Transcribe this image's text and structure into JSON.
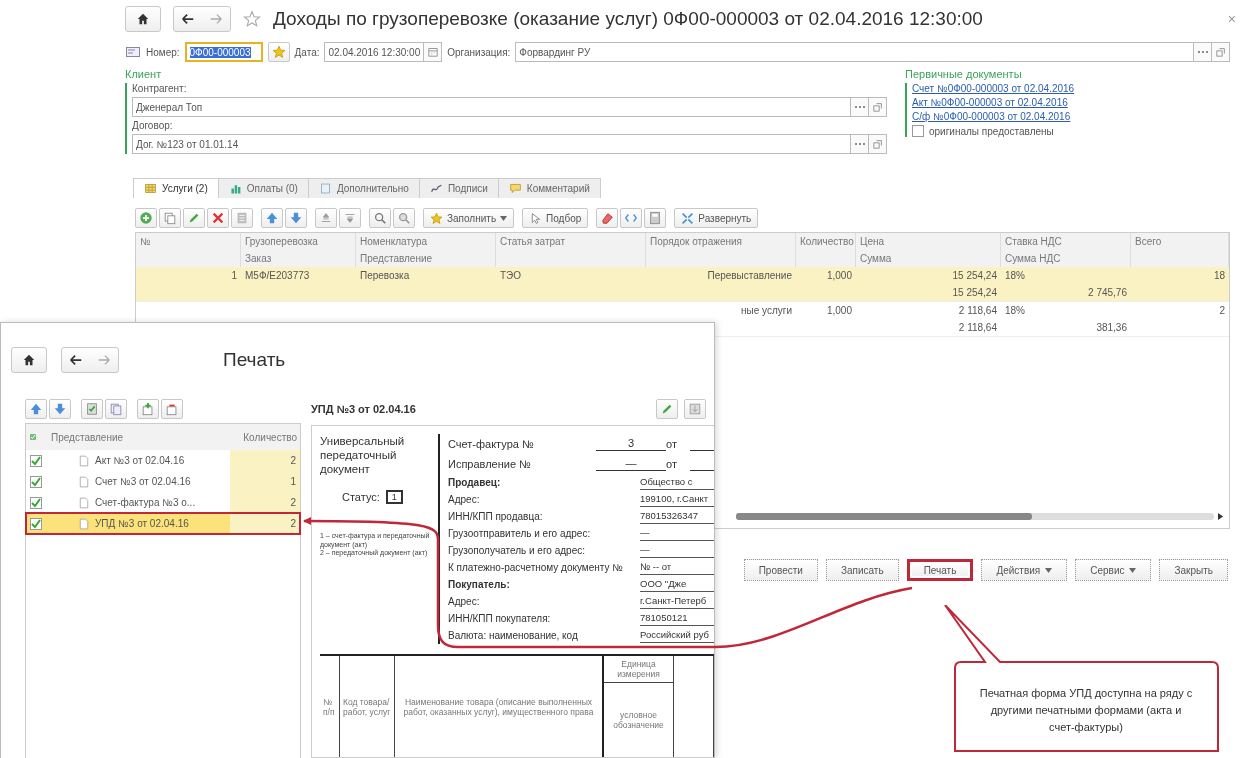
{
  "main_window": {
    "title": "Доходы по грузоперевозке (оказание услуг) 0Ф00-000003 от 02.04.2016 12:30:00",
    "close": "×",
    "header": {
      "number_label": "Номер:",
      "number": "0Ф00-000003",
      "date_label": "Дата:",
      "date": "02.04.2016 12:30:00",
      "org_label": "Организация:",
      "org": "Форвардинг РУ"
    },
    "client": {
      "title": "Клиент",
      "counterparty_label": "Контрагент:",
      "counterparty": "Дженерал Топ",
      "contract_label": "Договор:",
      "contract": "Дог. №123 от 01.01.14"
    },
    "primary_docs": {
      "title": "Первичные документы",
      "links": [
        "Счет №0Ф00-000003 от 02.04.2016",
        "Акт №0Ф00-000003 от 02.04.2016",
        "С/ф №0Ф00-000003 от 02.04.2016"
      ],
      "originals": {
        "label": "оригиналы предоставлены",
        "checked": false
      }
    },
    "tabs": [
      {
        "label": "Услуги (2)",
        "selected": true
      },
      {
        "label": "Оплаты (0)",
        "selected": false
      },
      {
        "label": "Дополнительно",
        "selected": false
      },
      {
        "label": "Подписи",
        "selected": false
      },
      {
        "label": "Комментарий",
        "selected": false
      }
    ],
    "toolbar": {
      "fill": "Заполнить",
      "pick": "Подбор",
      "expand": "Развернуть"
    },
    "table": {
      "columns": [
        {
          "label": "№"
        },
        {
          "label": "Грузоперевозка",
          "sub": "Заказ"
        },
        {
          "label": "Номенклатура",
          "sub": "Представление"
        },
        {
          "label": "Статья затрат"
        },
        {
          "label": "Порядок отражения"
        },
        {
          "label": "Количество"
        },
        {
          "label": "Цена",
          "sub": "Сумма"
        },
        {
          "label": "Ставка НДС",
          "sub": "Сумма НДС"
        },
        {
          "label": "Всего"
        }
      ],
      "rows": [
        {
          "selected": true,
          "cells": {
            "number": "1",
            "cargo": "М5Ф/Е203773",
            "nomenclature": "Перевозка",
            "cost_item": "ТЭО",
            "reflection": "Перевыставление",
            "quantity": "1,000",
            "price": "15 254,24",
            "vat_rate": "18%",
            "total": "18",
            "sum": "15 254,24",
            "vat_sum": "2 745,76"
          }
        },
        {
          "selected": false,
          "cells": {
            "reflection": "ные услуги",
            "quantity": "1,000",
            "price": "2 118,64",
            "vat_rate": "18%",
            "total": "2",
            "sum": "2 118,64",
            "vat_sum": "381,36"
          }
        }
      ]
    },
    "buttons": [
      {
        "label": "Провести",
        "dropdown": false,
        "highlighted": false
      },
      {
        "label": "Записать",
        "dropdown": false,
        "highlighted": false
      },
      {
        "label": "Печать",
        "dropdown": false,
        "highlighted": true
      },
      {
        "label": "Действия",
        "dropdown": true,
        "highlighted": false
      },
      {
        "label": "Сервис",
        "dropdown": true,
        "highlighted": false
      },
      {
        "label": "Закрыть",
        "dropdown": false,
        "highlighted": false
      }
    ]
  },
  "print_window": {
    "title": "Печать",
    "list": {
      "columns": [
        "Представление",
        "Количество"
      ],
      "items": [
        {
          "label": "Акт №3 от 02.04.16",
          "quantity": "2",
          "checked": true,
          "selected": false
        },
        {
          "label": "Счет №3 от 02.04.16",
          "quantity": "1",
          "checked": true,
          "selected": false
        },
        {
          "label": "Счет-фактура №3 о...",
          "quantity": "2",
          "checked": true,
          "selected": false
        },
        {
          "label": "УПД №3 от 02.04.16",
          "quantity": "2",
          "checked": true,
          "selected": true
        }
      ]
    },
    "preview": {
      "title": "УПД №3 от 02.04.16",
      "doc_type": "Универсальный передаточный документ",
      "status_label": "Статус:",
      "status": "1",
      "legend": [
        "1 – счет-фактура и передаточный документ (акт)",
        "2 – передаточный документ (акт)"
      ],
      "invoice": [
        {
          "label": "Счет-фактура №",
          "value": "3",
          "date_label": "от"
        },
        {
          "label": "Исправление №",
          "value": "—",
          "date_label": "от"
        }
      ],
      "fields": [
        {
          "kind": "heading",
          "label": "Продавец:",
          "value": "Общество с"
        },
        {
          "kind": "field",
          "label": "Адрес:",
          "value": "199100, г.Санкт"
        },
        {
          "kind": "field",
          "label": "ИНН/КПП продавца:",
          "value": "78015326347"
        },
        {
          "kind": "field",
          "label": "Грузоотправитель и его адрес:",
          "value": "—"
        },
        {
          "kind": "field",
          "label": "Грузополучатель и его адрес:",
          "value": "—"
        },
        {
          "kind": "field",
          "label": "К платежно-расчетному документу №",
          "value": "№ -- от"
        },
        {
          "kind": "heading",
          "label": "Покупатель:",
          "value": "ООО \"Дже"
        },
        {
          "kind": "field",
          "label": "Адрес:",
          "value": "г.Санкт-Петерб"
        },
        {
          "kind": "field",
          "label": "ИНН/КПП покупателя:",
          "value": "781050121"
        },
        {
          "kind": "field",
          "label": "Валюта: наименование, код",
          "value": "Российский руб"
        }
      ],
      "table_columns": [
        "№ п/п",
        "Код товара/ работ, услуг",
        "Наименование товара (описание выполненных работ, оказанных услуг), имущественного права",
        "Единица измерения",
        "условное обозначение"
      ]
    }
  },
  "callout": {
    "text": "Печатная форма УПД доступна на ряду с другими печатными формами (акта и счет-фактуры)"
  }
}
